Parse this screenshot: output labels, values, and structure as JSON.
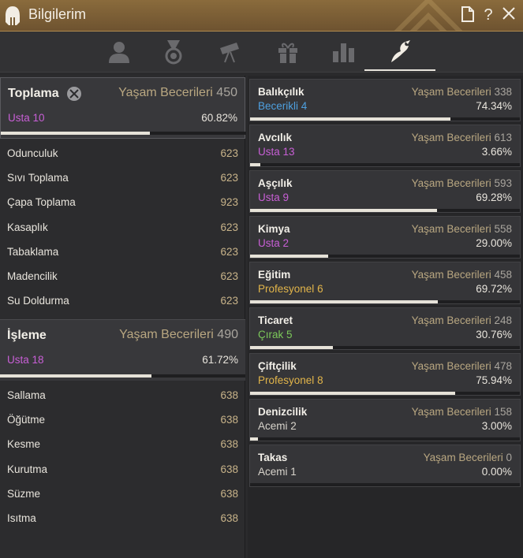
{
  "window": {
    "title": "Bilgilerim"
  },
  "title_buttons": [
    "page-icon",
    "help-icon",
    "close-icon"
  ],
  "tabs": [
    {
      "icon": "person-icon",
      "active": false
    },
    {
      "icon": "medal-icon",
      "active": false
    },
    {
      "icon": "telescope-icon",
      "active": false
    },
    {
      "icon": "gift-icon",
      "active": false
    },
    {
      "icon": "bar-chart-icon",
      "active": false
    },
    {
      "icon": "life-skill-icon",
      "active": true
    }
  ],
  "groups": [
    {
      "title": "Toplama",
      "ls_label": "Yaşam Becerileri",
      "ls_value": "450",
      "rank": "Usta 10",
      "percent": "60.82%",
      "progress": 0.6082,
      "items": [
        {
          "name": "Odunculuk",
          "value": "623"
        },
        {
          "name": "Sıvı Toplama",
          "value": "623"
        },
        {
          "name": "Çapa Toplama",
          "value": "923"
        },
        {
          "name": "Kasaplık",
          "value": "623"
        },
        {
          "name": "Tabaklama",
          "value": "623"
        },
        {
          "name": "Madencilik",
          "value": "623"
        },
        {
          "name": "Su Doldurma",
          "value": "623"
        }
      ]
    },
    {
      "title": "İşleme",
      "ls_label": "Yaşam Becerileri",
      "ls_value": "490",
      "rank": "Usta 18",
      "percent": "61.72%",
      "progress": 0.6172,
      "items": [
        {
          "name": "Sallama",
          "value": "638"
        },
        {
          "name": "Öğütme",
          "value": "638"
        },
        {
          "name": "Kesme",
          "value": "638"
        },
        {
          "name": "Kurutma",
          "value": "638"
        },
        {
          "name": "Süzme",
          "value": "638"
        },
        {
          "name": "Isıtma",
          "value": "638"
        }
      ]
    }
  ],
  "skills": [
    {
      "name": "Balıkçılık",
      "ls_label": "Yaşam Becerileri",
      "ls_value": "338",
      "rank": "Becerikli",
      "level": "4",
      "rank_class": "r-beceri",
      "percent": "74.34%",
      "progress": 0.7434
    },
    {
      "name": "Avcılık",
      "ls_label": "Yaşam Becerileri",
      "ls_value": "613",
      "rank": "Usta",
      "level": "13",
      "rank_class": "r-usta",
      "percent": "3.66%",
      "progress": 0.0366
    },
    {
      "name": "Aşçılık",
      "ls_label": "Yaşam Becerileri",
      "ls_value": "593",
      "rank": "Usta",
      "level": "9",
      "rank_class": "r-usta",
      "percent": "69.28%",
      "progress": 0.6928
    },
    {
      "name": "Kimya",
      "ls_label": "Yaşam Becerileri",
      "ls_value": "558",
      "rank": "Usta",
      "level": "2",
      "rank_class": "r-usta",
      "percent": "29.00%",
      "progress": 0.29
    },
    {
      "name": "Eğitim",
      "ls_label": "Yaşam Becerileri",
      "ls_value": "458",
      "rank": "Profesyonel",
      "level": "6",
      "rank_class": "r-prof",
      "percent": "69.72%",
      "progress": 0.6972
    },
    {
      "name": "Ticaret",
      "ls_label": "Yaşam Becerileri",
      "ls_value": "248",
      "rank": "Çırak",
      "level": "5",
      "rank_class": "r-cirak",
      "percent": "30.76%",
      "progress": 0.3076
    },
    {
      "name": "Çiftçilik",
      "ls_label": "Yaşam Becerileri",
      "ls_value": "478",
      "rank": "Profesyonel",
      "level": "8",
      "rank_class": "r-prof",
      "percent": "75.94%",
      "progress": 0.7594
    },
    {
      "name": "Denizcilik",
      "ls_label": "Yaşam Becerileri",
      "ls_value": "158",
      "rank": "Acemi",
      "level": "2",
      "rank_class": "r-acemi",
      "percent": "3.00%",
      "progress": 0.03
    },
    {
      "name": "Takas",
      "ls_label": "Yaşam Becerileri",
      "ls_value": "0",
      "rank": "Acemi",
      "level": "1",
      "rank_class": "r-acemi",
      "percent": "0.00%",
      "progress": 0.0
    }
  ],
  "colors": {
    "title_bar": "#7b5d35",
    "usta": "#c85fd6",
    "becerikli": "#4ea0e0",
    "profesyonel": "#e2b54a",
    "cirak": "#7cc95a",
    "acemi": "#d8d4cc"
  }
}
